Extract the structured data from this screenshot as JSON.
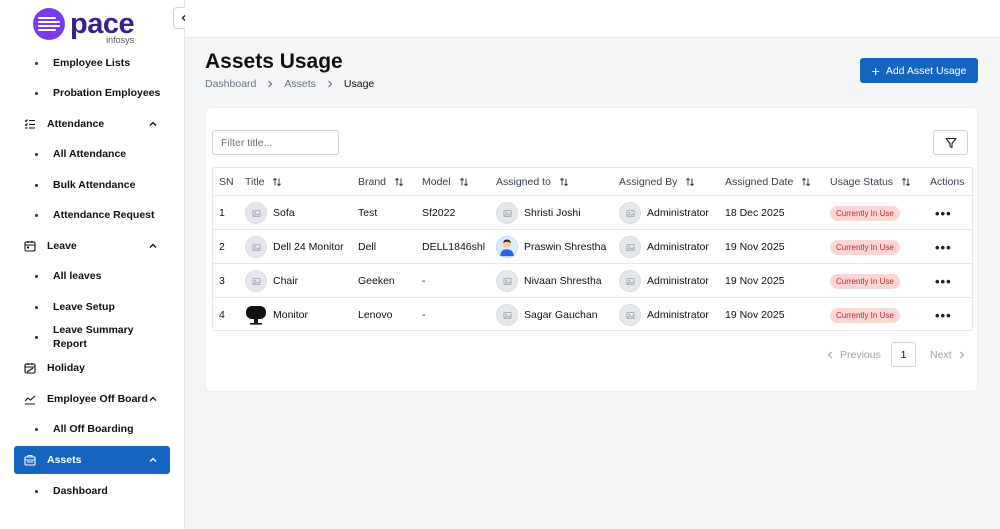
{
  "brand": {
    "name": "pace",
    "sub": "infosys",
    "color": "#7c3aed"
  },
  "sidebar": {
    "items": [
      {
        "type": "sub",
        "label": "Employee Lists"
      },
      {
        "type": "sub",
        "label": "Probation Employees"
      },
      {
        "type": "group",
        "label": "Attendance",
        "icon": "checklist-icon"
      },
      {
        "type": "sub",
        "label": "All Attendance"
      },
      {
        "type": "sub",
        "label": "Bulk Attendance"
      },
      {
        "type": "sub",
        "label": "Attendance Request"
      },
      {
        "type": "group",
        "label": "Leave",
        "icon": "calendar-icon"
      },
      {
        "type": "sub",
        "label": "All leaves"
      },
      {
        "type": "sub",
        "label": "Leave Setup"
      },
      {
        "type": "sub",
        "label": "Leave Summary Report"
      },
      {
        "type": "group",
        "label": "Holiday",
        "icon": "holiday-icon"
      },
      {
        "type": "group",
        "label": "Employee Off Board",
        "icon": "chart-icon"
      },
      {
        "type": "sub",
        "label": "All Off Boarding"
      },
      {
        "type": "group",
        "label": "Assets",
        "icon": "assets-icon",
        "active": true
      },
      {
        "type": "sub",
        "label": "Dashboard"
      }
    ]
  },
  "header": {
    "title": "Assets Usage",
    "breadcrumb": [
      "Dashboard",
      "Assets",
      "Usage"
    ],
    "add_label": "Add Asset Usage"
  },
  "filter": {
    "placeholder": "Filter title..."
  },
  "table": {
    "columns": [
      "SN",
      "Title",
      "Brand",
      "Model",
      "Assigned to",
      "Assigned By",
      "Assigned Date",
      "Usage Status",
      "Actions"
    ],
    "rows": [
      {
        "sn": "1",
        "title": "Sofa",
        "brand": "Test",
        "model": "Sf2022",
        "assigned_to": "Shristi Joshi",
        "assigned_by": "Administrator",
        "date": "18 Dec 2025",
        "status": "Currently In Use"
      },
      {
        "sn": "2",
        "title": "Dell 24 Monitor",
        "brand": "Dell",
        "model": "DELL1846shl",
        "assigned_to": "Praswin Shrestha",
        "assigned_by": "Administrator",
        "date": "19 Nov 2025",
        "status": "Currently In Use"
      },
      {
        "sn": "3",
        "title": "Chair",
        "brand": "Geeken",
        "model": "-",
        "assigned_to": "Nivaan Shrestha",
        "assigned_by": "Administrator",
        "date": "19 Nov 2025",
        "status": "Currently In Use"
      },
      {
        "sn": "4",
        "title": "Monitor",
        "brand": "Lenovo",
        "model": "-",
        "assigned_to": "Sagar Gauchan",
        "assigned_by": "Administrator",
        "date": "19 Nov 2025",
        "status": "Currently In Use"
      }
    ]
  },
  "pagination": {
    "previous": "Previous",
    "page": "1",
    "next": "Next"
  },
  "colors": {
    "accent": "#1565c0",
    "badge_bg": "#fcd5d5",
    "badge_text": "#c62828"
  }
}
